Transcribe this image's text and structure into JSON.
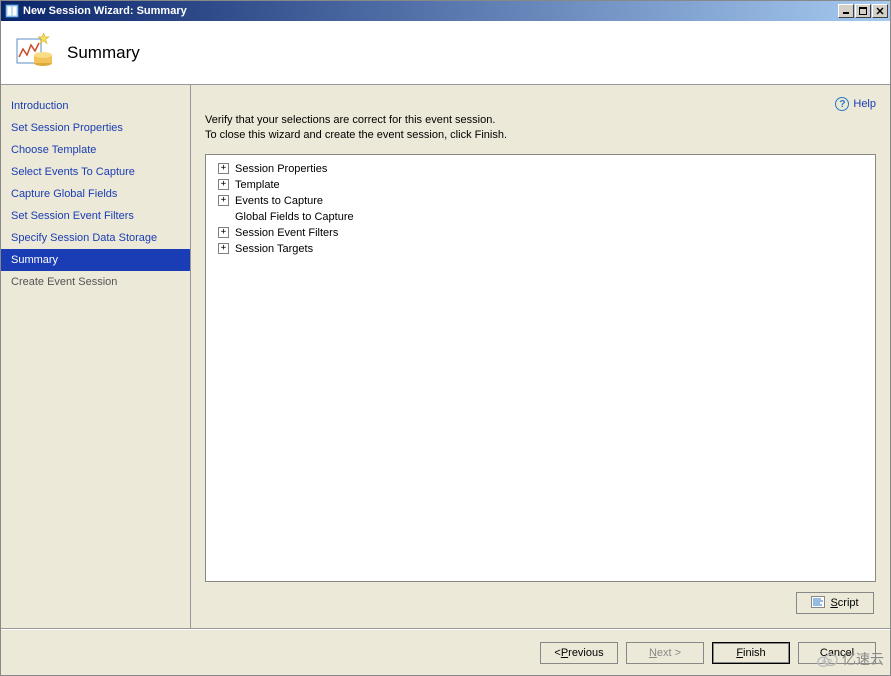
{
  "window": {
    "title": "New Session Wizard: Summary"
  },
  "header": {
    "title": "Summary"
  },
  "sidebar": {
    "items": [
      {
        "label": "Introduction",
        "active": false
      },
      {
        "label": "Set Session Properties",
        "active": false
      },
      {
        "label": "Choose Template",
        "active": false
      },
      {
        "label": "Select Events To Capture",
        "active": false
      },
      {
        "label": "Capture Global Fields",
        "active": false
      },
      {
        "label": "Set Session Event Filters",
        "active": false
      },
      {
        "label": "Specify Session Data Storage",
        "active": false
      },
      {
        "label": "Summary",
        "active": true
      },
      {
        "label": "Create Event Session",
        "active": false,
        "disabled": true
      }
    ]
  },
  "help": {
    "label": "Help"
  },
  "instructions": {
    "line1": "Verify that your selections are correct for this event session.",
    "line2": "To close this wizard and create the event session, click Finish."
  },
  "tree": {
    "nodes": [
      {
        "label": "Session Properties",
        "expandable": true
      },
      {
        "label": "Template",
        "expandable": true
      },
      {
        "label": "Events to Capture",
        "expandable": true
      },
      {
        "label": "Global Fields to Capture",
        "expandable": false,
        "child": true
      },
      {
        "label": "Session Event Filters",
        "expandable": true
      },
      {
        "label": "Session Targets",
        "expandable": true
      }
    ]
  },
  "script_button": {
    "label": "Script"
  },
  "footer": {
    "previous": {
      "prefix": "< ",
      "key": "P",
      "rest": "revious"
    },
    "next": {
      "key": "N",
      "rest": "ext >"
    },
    "finish": {
      "key": "F",
      "rest": "inish"
    },
    "cancel": "Cancel"
  },
  "watermark": "亿速云"
}
